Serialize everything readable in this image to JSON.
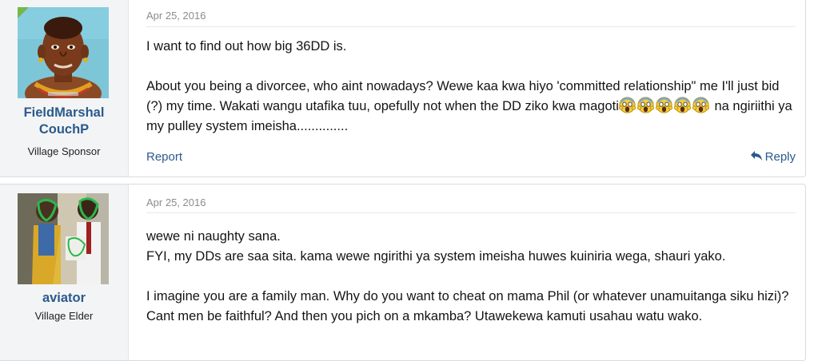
{
  "posts": [
    {
      "username_line1": "FieldMarshal",
      "username_line2": "CouchP",
      "user_title": "Village Sponsor",
      "date": "Apr 25, 2016",
      "body_line1": "I want to find out how big 36DD is.",
      "body_p2_a": "About you being a divorcee, who aint nowadays? Wewe kaa kwa hiyo 'committed relationship\" me I'll just bid (?) my time. Wakati wangu utafika tuu, opefully not when the DD ziko kwa magoti",
      "body_p2_b": "na ngiriithi ya my pulley system imeisha..............",
      "emoji": "scream-emoji",
      "report_label": "Report",
      "reply_label": "Reply",
      "online_indicator_color": "#74b74a"
    },
    {
      "username": "aviator",
      "user_title": "Village Elder",
      "date": "Apr 25, 2016",
      "body_line1": "wewe ni naughty sana.",
      "body_line2": "FYI, my DDs are saa sita. kama wewe ngirithi ya system imeisha huwes kuiniria wega, shauri yako.",
      "body_p2": "I imagine you are a family man. Why do you want to cheat on mama Phil (or whatever unamuitanga siku hizi)? Cant men be faithful? And then you pich on a mkamba? Utawekewa kamuti usahau watu wako."
    }
  ],
  "colors": {
    "link": "#2a5a8c",
    "sidebar_bg": "#f3f4f5",
    "date": "#8c8c8c"
  }
}
